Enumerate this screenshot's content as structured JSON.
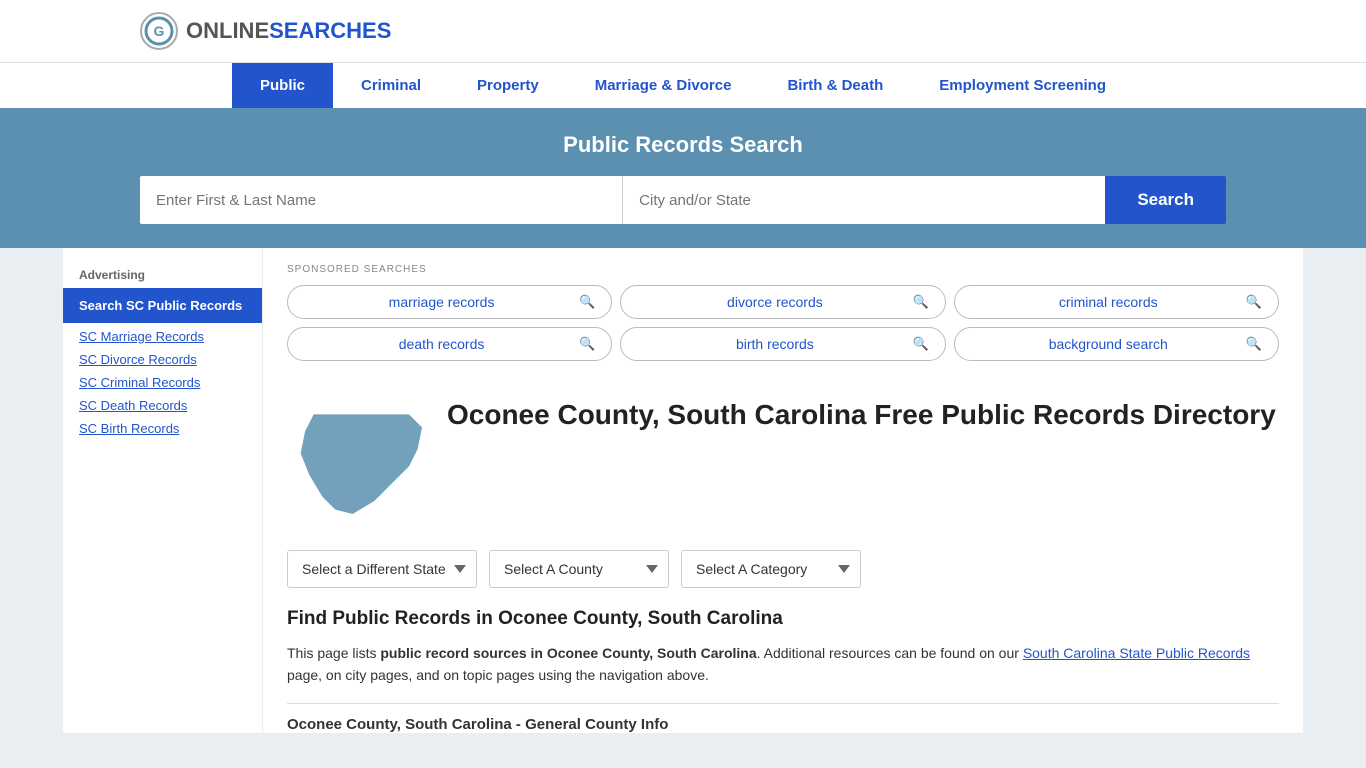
{
  "logo": {
    "online": "ONLINE",
    "searches": "SEARCHES",
    "alt": "OnlineSearches logo"
  },
  "nav": {
    "items": [
      {
        "label": "Public",
        "active": true
      },
      {
        "label": "Criminal",
        "active": false
      },
      {
        "label": "Property",
        "active": false
      },
      {
        "label": "Marriage & Divorce",
        "active": false
      },
      {
        "label": "Birth & Death",
        "active": false
      },
      {
        "label": "Employment Screening",
        "active": false
      }
    ]
  },
  "search_banner": {
    "title": "Public Records Search",
    "name_placeholder": "Enter First & Last Name",
    "city_placeholder": "City and/or State",
    "button_label": "Search"
  },
  "sponsored": {
    "label": "SPONSORED SEARCHES",
    "pills": [
      {
        "text": "marriage records"
      },
      {
        "text": "divorce records"
      },
      {
        "text": "criminal records"
      },
      {
        "text": "death records"
      },
      {
        "text": "birth records"
      },
      {
        "text": "background search"
      }
    ]
  },
  "directory": {
    "title": "Oconee County, South Carolina Free Public Records Directory"
  },
  "dropdowns": {
    "state": {
      "label": "Select a Different State"
    },
    "county": {
      "label": "Select A County"
    },
    "category": {
      "label": "Select A Category"
    }
  },
  "find_records": {
    "title": "Find Public Records in Oconee County, South Carolina",
    "text_before": "This page lists ",
    "text_bold": "public record sources in Oconee County, South Carolina",
    "text_after": ". Additional resources can be found on our ",
    "link_text": "South Carolina State Public Records",
    "text_end": " page, on city pages, and on topic pages using the navigation above."
  },
  "sidebar": {
    "ad_label": "Advertising",
    "ad_item": "Search SC Public Records",
    "links": [
      "SC Marriage Records",
      "SC Divorce Records",
      "SC Criminal Records",
      "SC Death Records",
      "SC Birth Records"
    ]
  },
  "general_info": {
    "title": "Oconee County, South Carolina - General County Info"
  }
}
